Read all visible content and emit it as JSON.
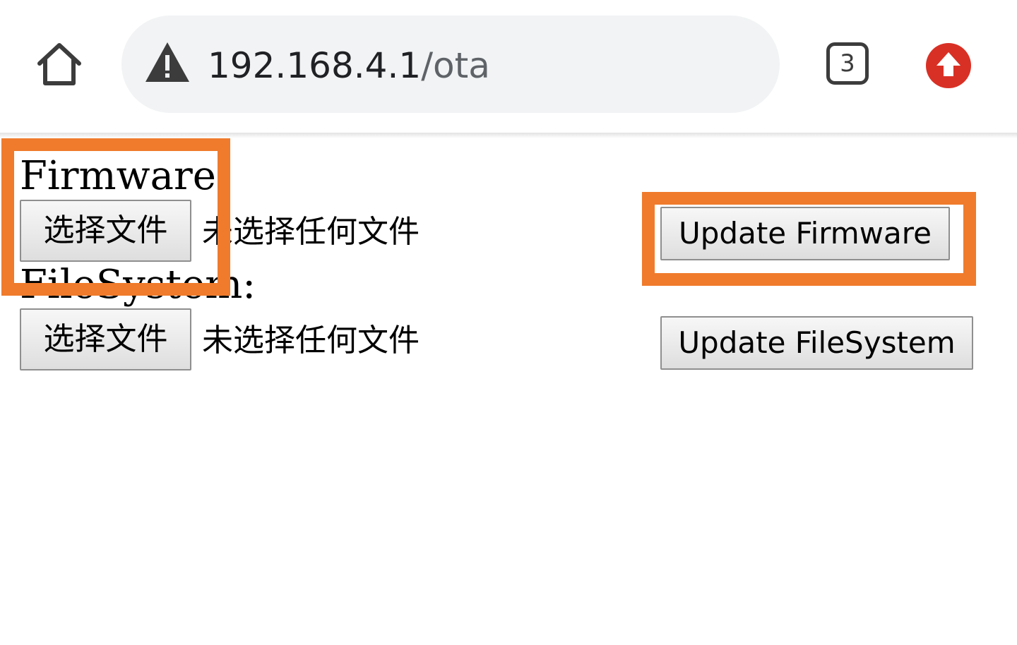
{
  "browser": {
    "url_host": "192.168.4.1",
    "url_path": "/ota",
    "tab_count": "3",
    "icons": {
      "home": "home-icon",
      "security": "warning-triangle-icon",
      "tabs": "tab-switcher-icon",
      "update": "upload-arrow-icon"
    },
    "colors": {
      "omnibox_bg": "#f1f3f4",
      "update_badge": "#d93025",
      "icon": "#3c3c3c"
    }
  },
  "page": {
    "firmware": {
      "label": "Firmware:",
      "choose_label": "选择文件",
      "status_text": "未选择任何文件",
      "submit_label": "Update Firmware"
    },
    "filesystem": {
      "label": "FileSystem:",
      "choose_label": "选择文件",
      "status_text": "未选择任何文件",
      "submit_label": "Update FileSystem"
    }
  },
  "annotations": {
    "highlight_color": "#f07b2c"
  }
}
